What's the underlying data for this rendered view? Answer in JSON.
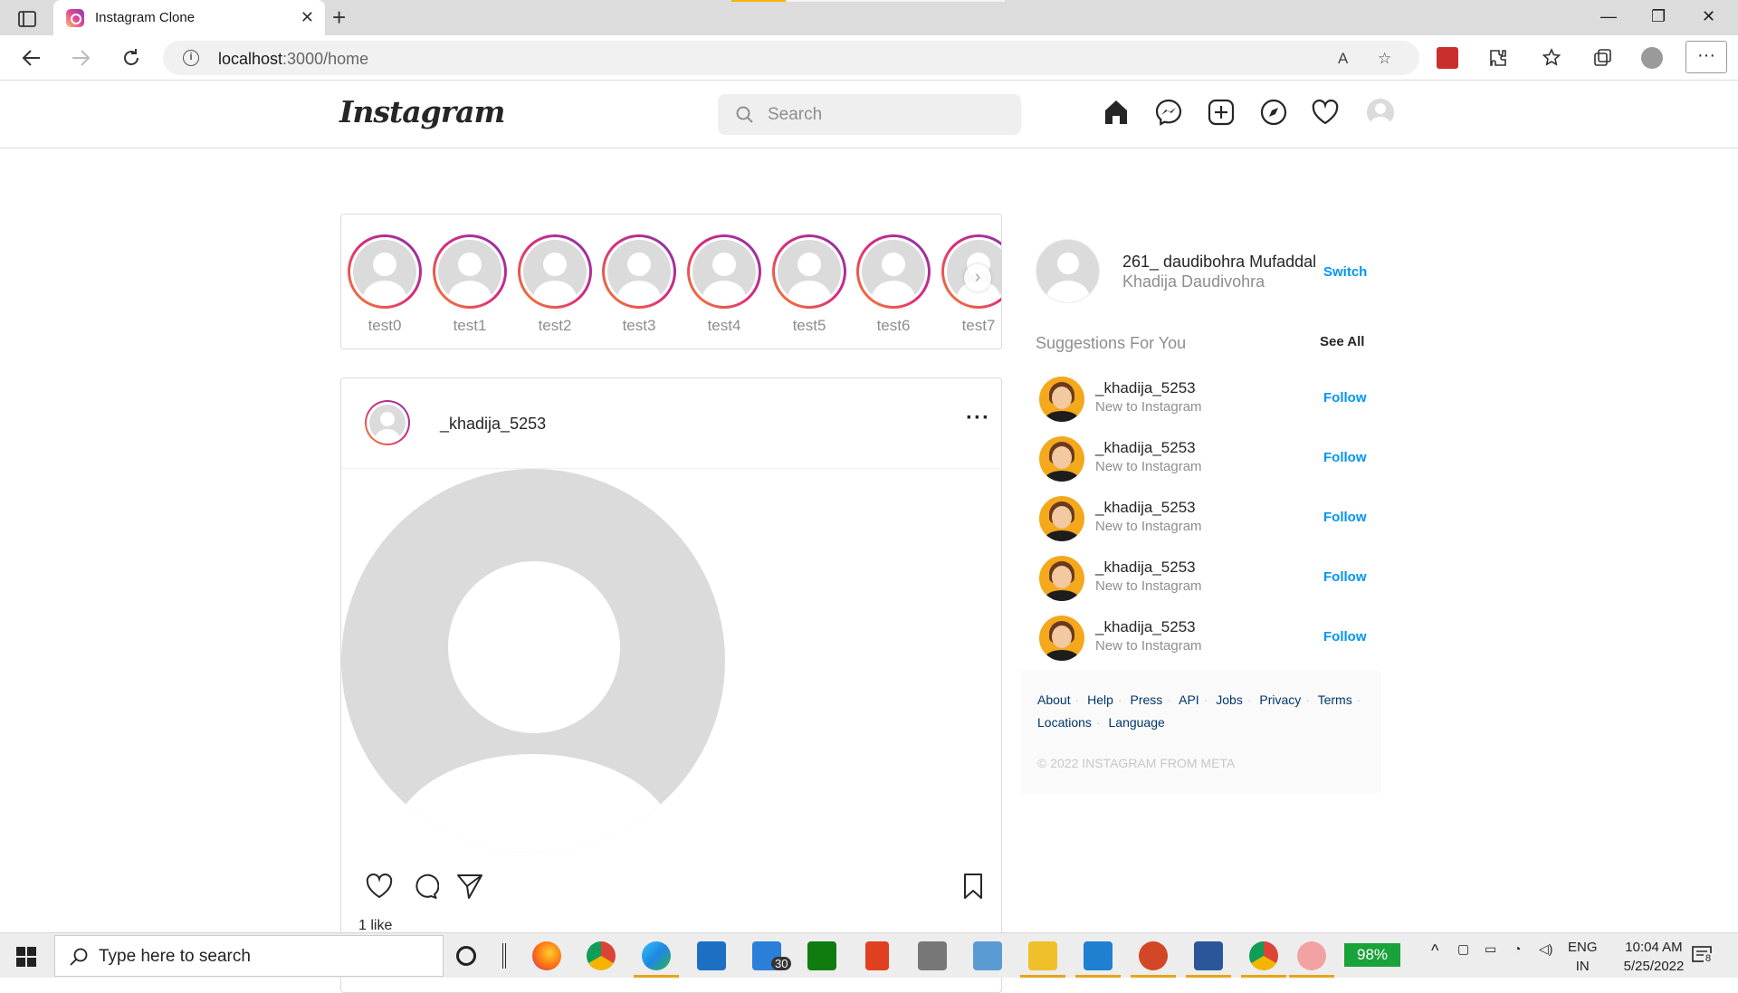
{
  "browser": {
    "tab_title": "Instagram Clone",
    "url_host": "localhost",
    "url_path": ":3000/home"
  },
  "header": {
    "logo": "Instagram",
    "search_placeholder": "Search"
  },
  "stories": [
    {
      "name": "test0"
    },
    {
      "name": "test1"
    },
    {
      "name": "test2"
    },
    {
      "name": "test3"
    },
    {
      "name": "test4"
    },
    {
      "name": "test5"
    },
    {
      "name": "test6"
    },
    {
      "name": "test7"
    }
  ],
  "post": {
    "username": "_khadija_5253",
    "more": "···",
    "likes": "1 like"
  },
  "sidebar": {
    "username": "261_ daudibohra Mufaddal",
    "fullname": "Khadija Daudivohra",
    "switch_label": "Switch",
    "suggestions_title": "Suggestions For You",
    "see_all_label": "See All",
    "suggestions": [
      {
        "username": "_khadija_5253",
        "subtitle": "New to Instagram",
        "action": "Follow"
      },
      {
        "username": "_khadija_5253",
        "subtitle": "New to Instagram",
        "action": "Follow"
      },
      {
        "username": "_khadija_5253",
        "subtitle": "New to Instagram",
        "action": "Follow"
      },
      {
        "username": "_khadija_5253",
        "subtitle": "New to Instagram",
        "action": "Follow"
      },
      {
        "username": "_khadija_5253",
        "subtitle": "New to Instagram",
        "action": "Follow"
      }
    ],
    "footer_links": [
      "About",
      "Help",
      "Press",
      "API",
      "Jobs",
      "Privacy",
      "Terms",
      "Locations",
      "Language"
    ],
    "copyright": "© 2022 INSTAGRAM FROM META"
  },
  "taskbar": {
    "search_placeholder": "Type here to search",
    "mail_badge": "30",
    "battery": "98%",
    "lang_1": "ENG",
    "lang_2": "IN",
    "time": "10:04 AM",
    "date": "5/25/2022",
    "notification_count": "8"
  },
  "colors": {
    "accent": "#0095f6",
    "border": "#dbdbdb",
    "muted": "#8e8e8e"
  }
}
